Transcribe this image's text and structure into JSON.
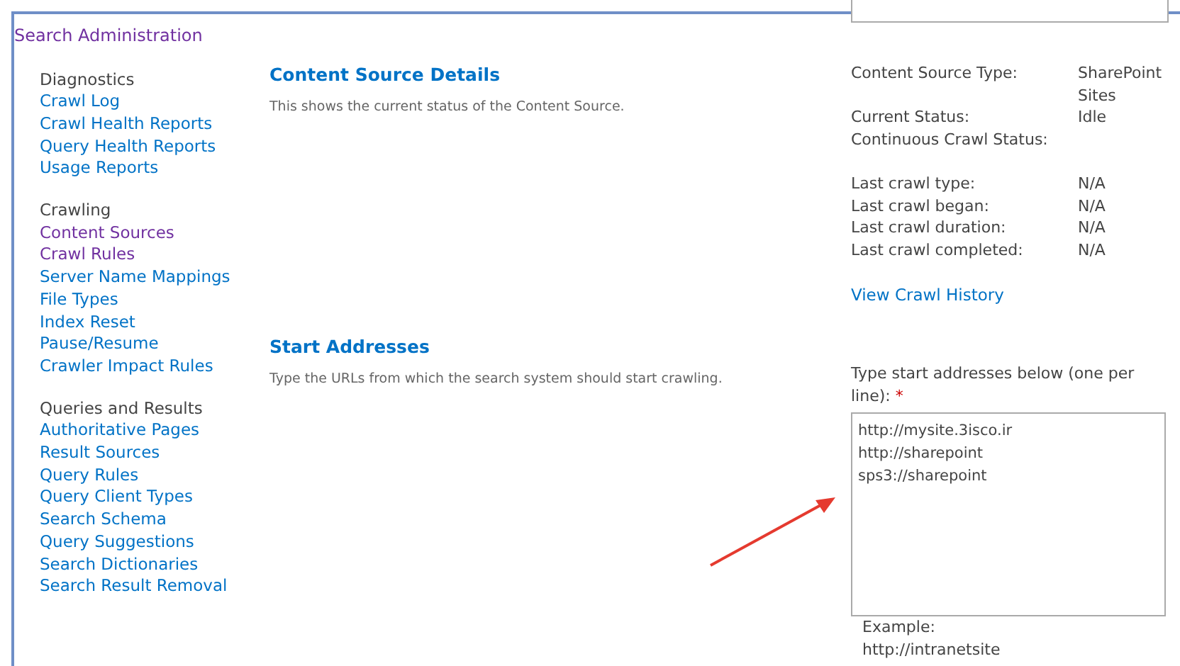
{
  "breadcrumb": {
    "label": "Search Administration",
    "visited": true
  },
  "sidebar": {
    "groups": [
      {
        "heading": "Diagnostics",
        "items": [
          {
            "label": "Crawl Log",
            "visited": false
          },
          {
            "label": "Crawl Health Reports",
            "visited": false
          },
          {
            "label": "Query Health Reports",
            "visited": false
          },
          {
            "label": "Usage Reports",
            "visited": false
          }
        ]
      },
      {
        "heading": "Crawling",
        "items": [
          {
            "label": "Content Sources",
            "visited": true
          },
          {
            "label": "Crawl Rules",
            "visited": true
          },
          {
            "label": "Server Name Mappings",
            "visited": false
          },
          {
            "label": "File Types",
            "visited": false
          },
          {
            "label": "Index Reset",
            "visited": false
          },
          {
            "label": "Pause/Resume",
            "visited": false
          },
          {
            "label": "Crawler Impact Rules",
            "visited": false
          }
        ]
      },
      {
        "heading": "Queries and Results",
        "items": [
          {
            "label": "Authoritative Pages",
            "visited": false
          },
          {
            "label": "Result Sources",
            "visited": false
          },
          {
            "label": "Query Rules",
            "visited": false
          },
          {
            "label": "Query Client Types",
            "visited": false
          },
          {
            "label": "Search Schema",
            "visited": false
          },
          {
            "label": "Query Suggestions",
            "visited": false
          },
          {
            "label": "Search Dictionaries",
            "visited": false
          },
          {
            "label": "Search Result Removal",
            "visited": false
          }
        ]
      }
    ]
  },
  "details": {
    "title": "Content Source Details",
    "description": "This shows the current status of the Content Source.",
    "status_rows": [
      {
        "label": "Content Source Type:",
        "value": "SharePoint Sites"
      },
      {
        "label": "Current Status:",
        "value": "Idle"
      },
      {
        "label": "Continuous Crawl Status:",
        "value": ""
      }
    ],
    "crawl_rows": [
      {
        "label": "Last crawl type:",
        "value": "N/A"
      },
      {
        "label": "Last crawl began:",
        "value": "N/A"
      },
      {
        "label": "Last crawl duration:",
        "value": "N/A"
      },
      {
        "label": "Last crawl completed:",
        "value": "N/A"
      }
    ],
    "history_link": "View Crawl History"
  },
  "start_addresses": {
    "title": "Start Addresses",
    "description": "Type the URLs from which the search system should start crawling.",
    "field_label": "Type start addresses below (one per line):",
    "required_mark": "*",
    "value": "http://mysite.3isco.ir\nhttp://sharepoint\nsps3://sharepoint",
    "example_label": "Example:",
    "example_value": "http://intranetsite"
  }
}
